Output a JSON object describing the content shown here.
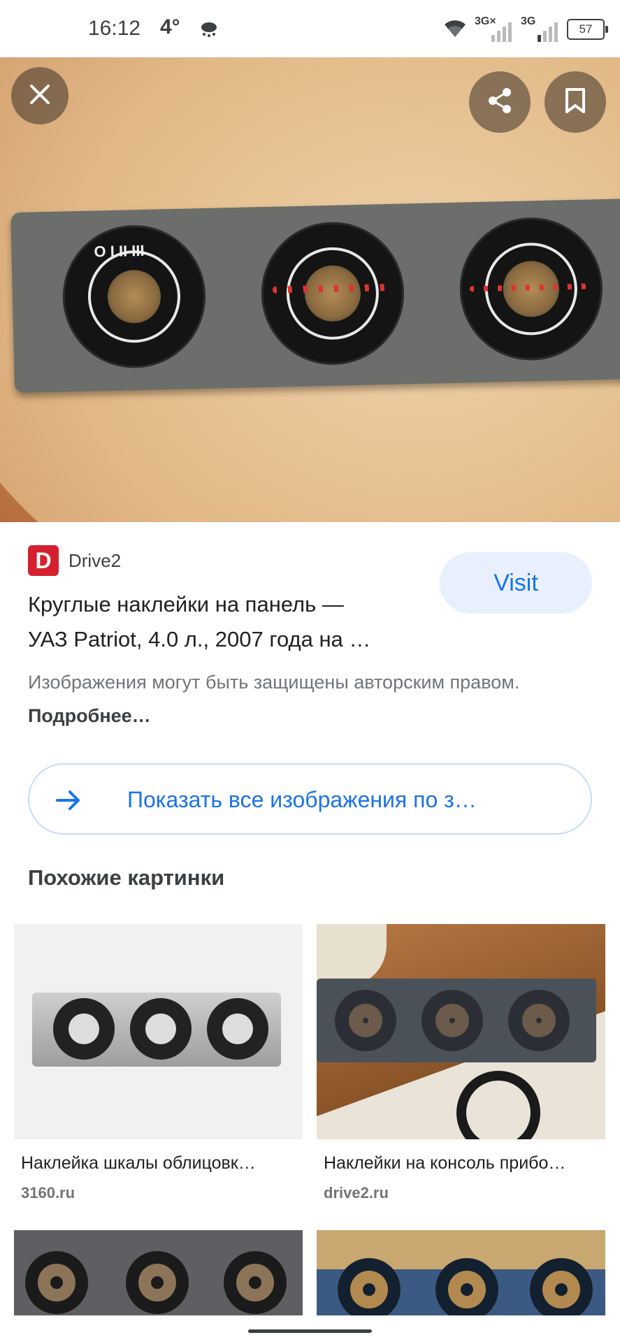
{
  "status_bar": {
    "time": "16:12",
    "temperature": "4°",
    "weather_icon": "cloud-rain-icon",
    "signal_1_label": "3G×",
    "signal_2_label": "3G",
    "battery": "57"
  },
  "hero": {
    "close_icon": "close-icon",
    "share_icon": "share-icon",
    "bookmark_icon": "bookmark-icon"
  },
  "result": {
    "source_logo": "D",
    "source_name": "Drive2",
    "visit_label": "Visit",
    "title_line1": "Круглые наклейки на панель —",
    "title_line2": "УАЗ Patriot, 4.0 л., 2007 года на …",
    "copyright_text": "Изображения могут быть защищены авторским правом. ",
    "copyright_link": "Подробнее…"
  },
  "show_all": {
    "label": "Показать все изображения по з…"
  },
  "similar": {
    "title": "Похожие картинки",
    "items": [
      {
        "caption": "Наклейка шкалы облицовк…",
        "source": "3160.ru"
      },
      {
        "caption": "Наклейки на консоль прибо…",
        "source": "drive2.ru"
      },
      {
        "caption": "",
        "source": ""
      },
      {
        "caption": "",
        "source": ""
      }
    ]
  },
  "colors": {
    "accent": "#1a73e8",
    "visit_bg": "#e8f0fe",
    "logo_red": "#d5202f"
  }
}
